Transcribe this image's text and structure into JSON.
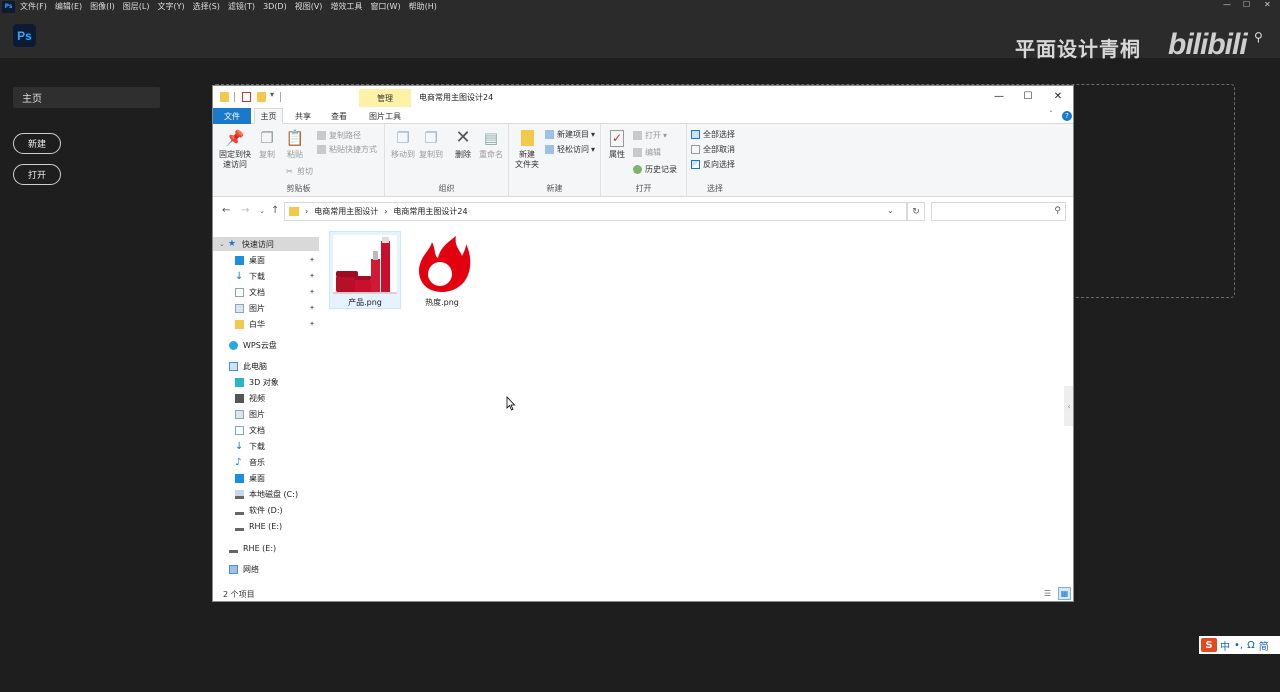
{
  "ps": {
    "menus": [
      "文件(F)",
      "编辑(E)",
      "图像(I)",
      "图层(L)",
      "文字(Y)",
      "选择(S)",
      "滤镜(T)",
      "3D(D)",
      "视图(V)",
      "增效工具",
      "窗口(W)",
      "帮助(H)"
    ],
    "mini_logo": "Ps",
    "logo": "Ps",
    "home": "主页",
    "new_button": "新建",
    "open_button": "打开",
    "watermark": "平面设计青桐",
    "bili_logo": "bilibili",
    "window_controls": [
      "—",
      "☐",
      "✕"
    ]
  },
  "explorer": {
    "title": "电商常用主图设计24",
    "manage_tab": "管理",
    "picture_tools_tab": "图片工具",
    "tabs": {
      "file": "文件",
      "home": "主页",
      "share": "共享",
      "view": "查看"
    },
    "ribbon": {
      "clipboard": {
        "label": "剪贴板",
        "pin": "固定到快\n速访问",
        "copy": "复制",
        "paste": "粘贴",
        "copy_path": "复制路径",
        "paste_shortcut": "粘贴快捷方式",
        "cut": "剪切"
      },
      "organize": {
        "label": "组织",
        "move_to": "移动到",
        "copy_to": "复制到",
        "delete": "删除",
        "rename": "重命名"
      },
      "new": {
        "label": "新建",
        "new_folder": "新建\n文件夹",
        "new_item": "新建项目",
        "easy_access": "轻松访问"
      },
      "open": {
        "label": "打开",
        "properties": "属性",
        "open": "打开",
        "edit": "编辑",
        "history": "历史记录"
      },
      "select": {
        "label": "选择",
        "select_all": "全部选择",
        "select_none": "全部取消",
        "invert": "反向选择"
      }
    },
    "address": {
      "crumb1": "电商常用主图设计",
      "crumb2": "电商常用主图设计24",
      "separator": "›",
      "search_placeholder": ""
    },
    "nav": {
      "quick_access": "快速访问",
      "desktop": "桌面",
      "downloads": "下载",
      "documents": "文档",
      "pictures": "图片",
      "baihua": "白华",
      "wps": "WPS云盘",
      "this_pc": "此电脑",
      "objects3d": "3D 对象",
      "videos": "视频",
      "pictures2": "图片",
      "documents2": "文档",
      "downloads2": "下载",
      "music": "音乐",
      "desktop2": "桌面",
      "drive_c": "本地磁盘 (C:)",
      "drive_d": "软件 (D:)",
      "drive_e": "RHE (E:)",
      "drive_e2": "RHE (E:)",
      "network": "网络"
    },
    "files": [
      {
        "name": "产品.png"
      },
      {
        "name": "热度.png"
      }
    ],
    "status": "2 个项目"
  },
  "ime": {
    "logo": "S",
    "items": [
      "中",
      "•,",
      "Ω",
      "简"
    ]
  },
  "colors": {
    "ps_bg": "#1e1e1e",
    "ps_bar": "#2b2b2b",
    "ps_blue": "#31a8ff",
    "explorer_accent": "#1979ca",
    "manage_yellow": "#fdf2a8",
    "folder_yellow": "#f3c94c",
    "product_red": "#c8102e",
    "flame_red": "#e3000f"
  }
}
